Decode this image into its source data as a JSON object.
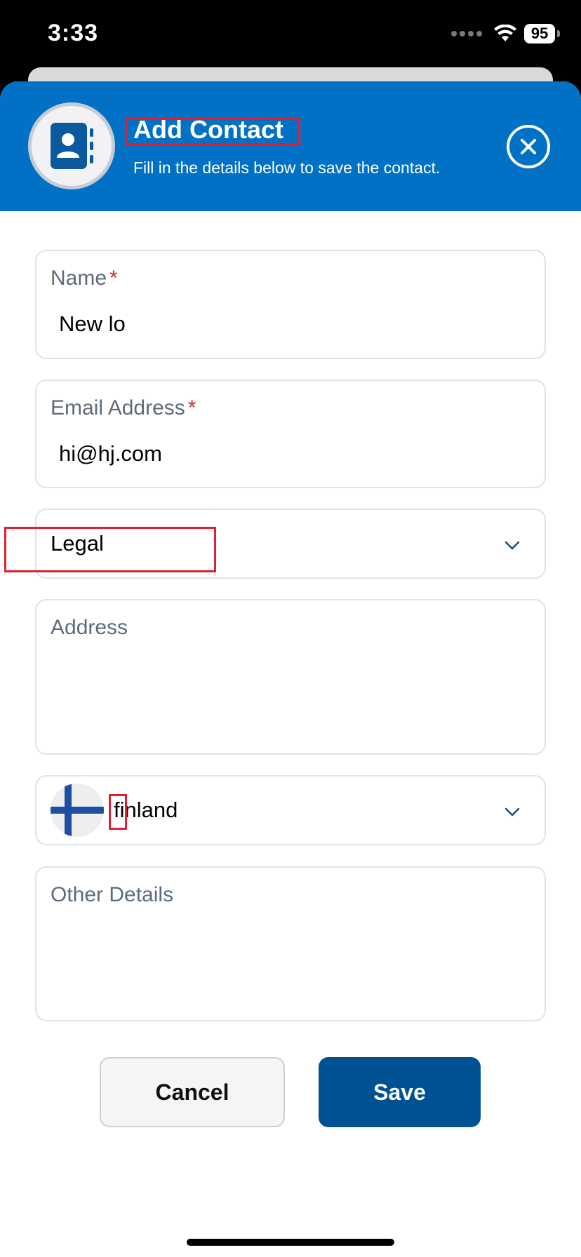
{
  "status_bar": {
    "time": "3:33",
    "battery": "95"
  },
  "header": {
    "title": "Add Contact",
    "subtitle": "Fill in the details below to save the contact.",
    "icon": "contact-book-icon",
    "close_icon": "close-circle-icon",
    "color": "#0071c5"
  },
  "form": {
    "name": {
      "label": "Name",
      "required_mark": "*",
      "value": "New lo"
    },
    "email": {
      "label": "Email Address",
      "required_mark": "*",
      "value": "hi@hj.com"
    },
    "category": {
      "selected": "Legal"
    },
    "address": {
      "placeholder": "Address",
      "value": ""
    },
    "country": {
      "selected": "finland",
      "flag_icon": "finland-flag-icon"
    },
    "other_details": {
      "placeholder": "Other Details",
      "value": ""
    }
  },
  "actions": {
    "cancel_label": "Cancel",
    "save_label": "Save",
    "save_color": "#005192"
  }
}
